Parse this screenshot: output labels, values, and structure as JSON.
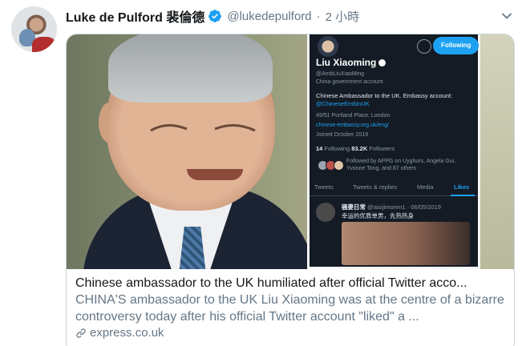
{
  "tweet": {
    "author_name": "Luke de Pulford 裴倫德",
    "handle": "@lukedepulford",
    "separator": "·",
    "time": "2 小時"
  },
  "card": {
    "title": "Chinese ambassador to the UK humiliated after official Twitter acco...",
    "description": "CHINA'S ambassador to the UK Liu Xiaoming was at the centre of a bizarre controversy today after his official Twitter account \"liked\" a ...",
    "domain": "express.co.uk"
  },
  "embedded_profile": {
    "follow_label": "Following",
    "name": "Liu Xiaoming",
    "handle": "@AmbLiuXiaoMing",
    "account_type": "China government account",
    "bio_line1": "Chinese Ambassador to the UK. Embassy account:",
    "bio_link": "@ChineseEmbinUK",
    "location": "49/51 Portland Place, London",
    "website": "chinese-embassy.org.uk/eng/",
    "joined": "Joined October 2019",
    "following_count": "14",
    "following_label": "Following",
    "followers_count": "83.2K",
    "followers_label": "Followers",
    "followed_by_line1": "Followed by APPG on Uyghurs, Angela Gui,",
    "followed_by_line2": "Yvonne Tong, and 87 others",
    "tabs": [
      "Tweets",
      "Tweets & replies",
      "Media",
      "Likes"
    ],
    "liked_user": "骚妻日常",
    "liked_handle_date": "@aisijimoren1 · 06/05/2019",
    "liked_text": "幸运的优质单男，先热热身"
  },
  "colors": {
    "verified_blue": "#1da1f2",
    "secondary_text": "#657786",
    "card_border": "#ccd6dd"
  },
  "icons": [
    "verified-icon",
    "chevron-down-icon",
    "link-icon"
  ]
}
